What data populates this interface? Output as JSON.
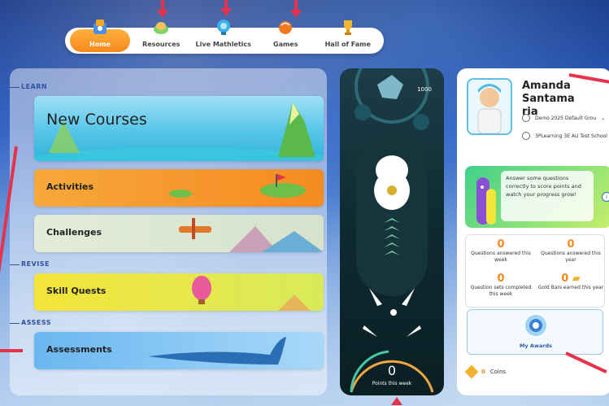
{
  "nav": {
    "items": [
      {
        "label": "Home",
        "icon": "home-icon",
        "active": true
      },
      {
        "label": "Resources",
        "icon": "resources-icon",
        "active": false
      },
      {
        "label": "Live Mathletics",
        "icon": "live-mathletics-icon",
        "active": false
      },
      {
        "label": "Games",
        "icon": "games-icon",
        "active": false
      },
      {
        "label": "Hall of Fame",
        "icon": "trophy-icon",
        "active": false
      }
    ]
  },
  "sections": {
    "learn": "LEARN",
    "revise": "REVISE",
    "assess": "ASSESS"
  },
  "cards": {
    "new_courses": "New Courses",
    "activities": "Activities",
    "challenges": "Challenges",
    "skill_quests": "Skill Quests",
    "assessments": "Assessments"
  },
  "pinball": {
    "badge": "1000",
    "points_value": "0",
    "points_label": "Points this week"
  },
  "profile": {
    "name_line1": "Amanda Santama",
    "name_line2": "ria",
    "group": "Demo 2025 Default Grou",
    "school": "3PLearning 3E AU Test School"
  },
  "promo": {
    "text": "Answer some questions correctly to score points and watch your progress grow!"
  },
  "stats": [
    {
      "value": "0",
      "label": "Questions answered this week"
    },
    {
      "value": "0",
      "label": "Questions answered this year"
    },
    {
      "value": "0",
      "label": "Question sets completed this week"
    },
    {
      "value": "0",
      "label": "Gold Bars earned this year"
    }
  ],
  "awards": {
    "label": "My Awards"
  },
  "coins": {
    "value": "0",
    "label": "Coins"
  },
  "colors": {
    "accent": "#f7891f",
    "marker": "#e8314b",
    "brand_blue": "#2f4f9e"
  }
}
